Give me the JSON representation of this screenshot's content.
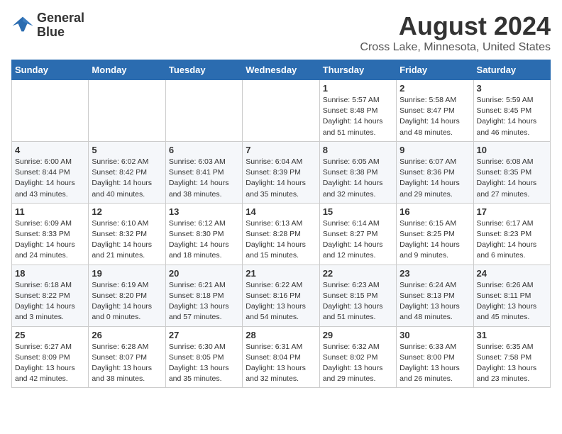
{
  "header": {
    "logo_line1": "General",
    "logo_line2": "Blue",
    "title": "August 2024",
    "subtitle": "Cross Lake, Minnesota, United States"
  },
  "weekdays": [
    "Sunday",
    "Monday",
    "Tuesday",
    "Wednesday",
    "Thursday",
    "Friday",
    "Saturday"
  ],
  "weeks": [
    [
      {
        "day": "",
        "info": ""
      },
      {
        "day": "",
        "info": ""
      },
      {
        "day": "",
        "info": ""
      },
      {
        "day": "",
        "info": ""
      },
      {
        "day": "1",
        "info": "Sunrise: 5:57 AM\nSunset: 8:48 PM\nDaylight: 14 hours and 51 minutes."
      },
      {
        "day": "2",
        "info": "Sunrise: 5:58 AM\nSunset: 8:47 PM\nDaylight: 14 hours and 48 minutes."
      },
      {
        "day": "3",
        "info": "Sunrise: 5:59 AM\nSunset: 8:45 PM\nDaylight: 14 hours and 46 minutes."
      }
    ],
    [
      {
        "day": "4",
        "info": "Sunrise: 6:00 AM\nSunset: 8:44 PM\nDaylight: 14 hours and 43 minutes."
      },
      {
        "day": "5",
        "info": "Sunrise: 6:02 AM\nSunset: 8:42 PM\nDaylight: 14 hours and 40 minutes."
      },
      {
        "day": "6",
        "info": "Sunrise: 6:03 AM\nSunset: 8:41 PM\nDaylight: 14 hours and 38 minutes."
      },
      {
        "day": "7",
        "info": "Sunrise: 6:04 AM\nSunset: 8:39 PM\nDaylight: 14 hours and 35 minutes."
      },
      {
        "day": "8",
        "info": "Sunrise: 6:05 AM\nSunset: 8:38 PM\nDaylight: 14 hours and 32 minutes."
      },
      {
        "day": "9",
        "info": "Sunrise: 6:07 AM\nSunset: 8:36 PM\nDaylight: 14 hours and 29 minutes."
      },
      {
        "day": "10",
        "info": "Sunrise: 6:08 AM\nSunset: 8:35 PM\nDaylight: 14 hours and 27 minutes."
      }
    ],
    [
      {
        "day": "11",
        "info": "Sunrise: 6:09 AM\nSunset: 8:33 PM\nDaylight: 14 hours and 24 minutes."
      },
      {
        "day": "12",
        "info": "Sunrise: 6:10 AM\nSunset: 8:32 PM\nDaylight: 14 hours and 21 minutes."
      },
      {
        "day": "13",
        "info": "Sunrise: 6:12 AM\nSunset: 8:30 PM\nDaylight: 14 hours and 18 minutes."
      },
      {
        "day": "14",
        "info": "Sunrise: 6:13 AM\nSunset: 8:28 PM\nDaylight: 14 hours and 15 minutes."
      },
      {
        "day": "15",
        "info": "Sunrise: 6:14 AM\nSunset: 8:27 PM\nDaylight: 14 hours and 12 minutes."
      },
      {
        "day": "16",
        "info": "Sunrise: 6:15 AM\nSunset: 8:25 PM\nDaylight: 14 hours and 9 minutes."
      },
      {
        "day": "17",
        "info": "Sunrise: 6:17 AM\nSunset: 8:23 PM\nDaylight: 14 hours and 6 minutes."
      }
    ],
    [
      {
        "day": "18",
        "info": "Sunrise: 6:18 AM\nSunset: 8:22 PM\nDaylight: 14 hours and 3 minutes."
      },
      {
        "day": "19",
        "info": "Sunrise: 6:19 AM\nSunset: 8:20 PM\nDaylight: 14 hours and 0 minutes."
      },
      {
        "day": "20",
        "info": "Sunrise: 6:21 AM\nSunset: 8:18 PM\nDaylight: 13 hours and 57 minutes."
      },
      {
        "day": "21",
        "info": "Sunrise: 6:22 AM\nSunset: 8:16 PM\nDaylight: 13 hours and 54 minutes."
      },
      {
        "day": "22",
        "info": "Sunrise: 6:23 AM\nSunset: 8:15 PM\nDaylight: 13 hours and 51 minutes."
      },
      {
        "day": "23",
        "info": "Sunrise: 6:24 AM\nSunset: 8:13 PM\nDaylight: 13 hours and 48 minutes."
      },
      {
        "day": "24",
        "info": "Sunrise: 6:26 AM\nSunset: 8:11 PM\nDaylight: 13 hours and 45 minutes."
      }
    ],
    [
      {
        "day": "25",
        "info": "Sunrise: 6:27 AM\nSunset: 8:09 PM\nDaylight: 13 hours and 42 minutes."
      },
      {
        "day": "26",
        "info": "Sunrise: 6:28 AM\nSunset: 8:07 PM\nDaylight: 13 hours and 38 minutes."
      },
      {
        "day": "27",
        "info": "Sunrise: 6:30 AM\nSunset: 8:05 PM\nDaylight: 13 hours and 35 minutes."
      },
      {
        "day": "28",
        "info": "Sunrise: 6:31 AM\nSunset: 8:04 PM\nDaylight: 13 hours and 32 minutes."
      },
      {
        "day": "29",
        "info": "Sunrise: 6:32 AM\nSunset: 8:02 PM\nDaylight: 13 hours and 29 minutes."
      },
      {
        "day": "30",
        "info": "Sunrise: 6:33 AM\nSunset: 8:00 PM\nDaylight: 13 hours and 26 minutes."
      },
      {
        "day": "31",
        "info": "Sunrise: 6:35 AM\nSunset: 7:58 PM\nDaylight: 13 hours and 23 minutes."
      }
    ]
  ]
}
